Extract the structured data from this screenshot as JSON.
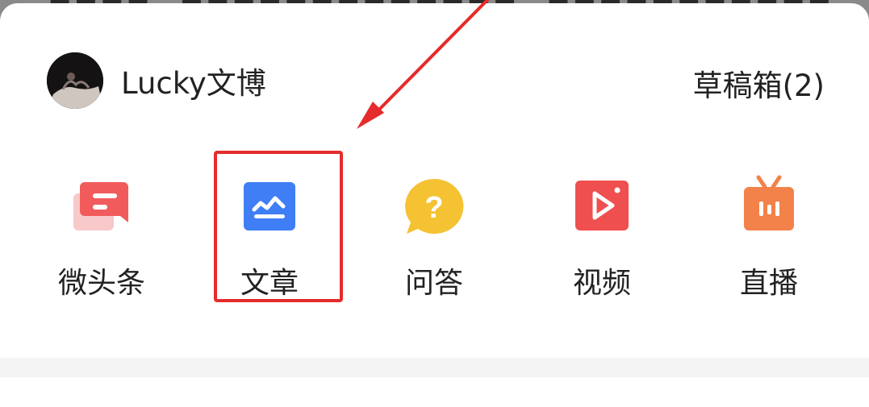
{
  "user": {
    "name": "Lucky文博"
  },
  "drafts_label": "草稿箱(2)",
  "actions": [
    {
      "label": "微头条",
      "icon": "micro-headline-icon",
      "color": "#f15b5b"
    },
    {
      "label": "文章",
      "icon": "article-icon",
      "color": "#3f7ef5"
    },
    {
      "label": "问答",
      "icon": "question-answer-icon",
      "color": "#f5c233"
    },
    {
      "label": "视频",
      "icon": "video-icon",
      "color": "#f04f4f"
    },
    {
      "label": "直播",
      "icon": "live-tv-icon",
      "color": "#f2824a"
    }
  ],
  "annotation": {
    "color": "#e52b2b"
  }
}
